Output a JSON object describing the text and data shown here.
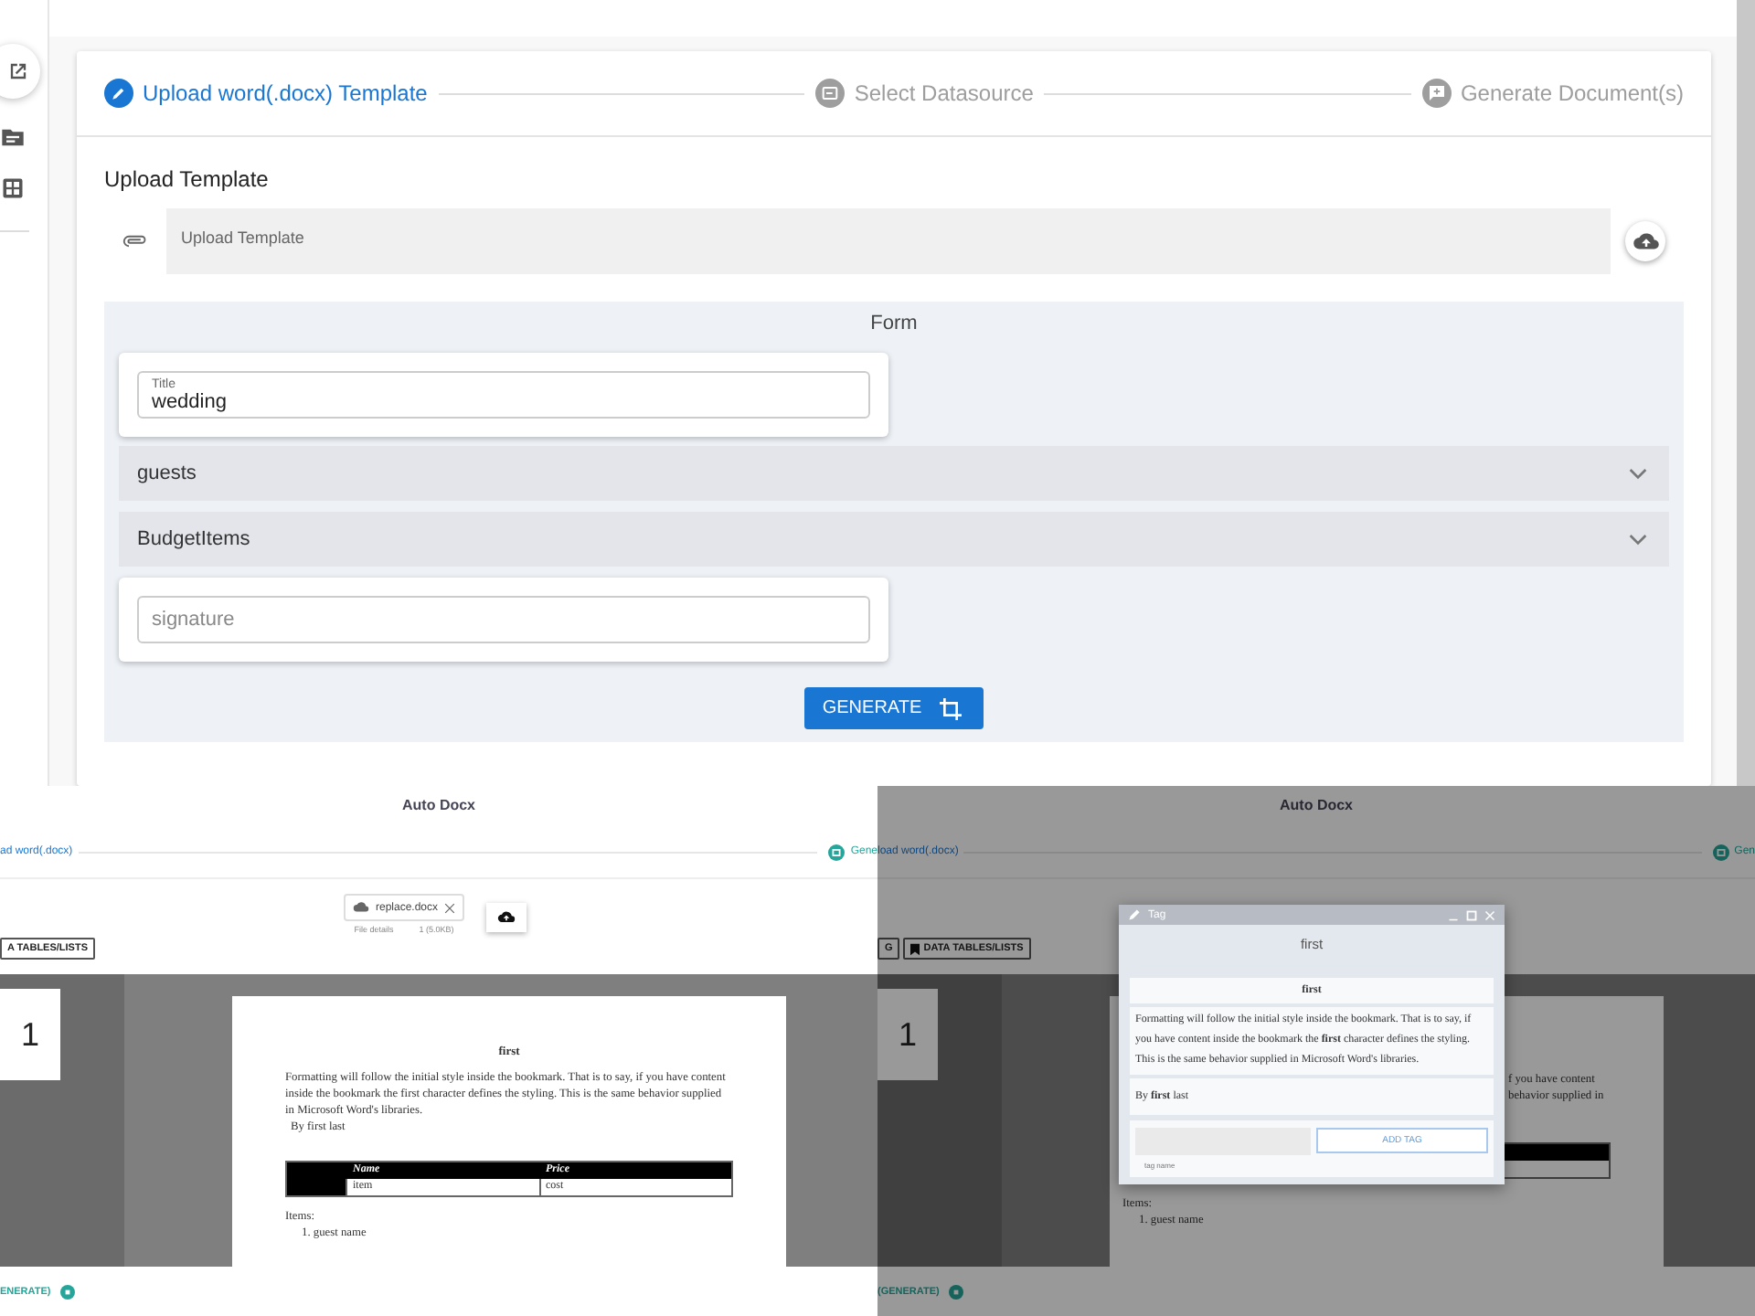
{
  "main": {
    "stepper": [
      {
        "label": "Upload word(.docx) Template",
        "kind": "edit",
        "selected": true
      },
      {
        "label": "Select Datasource",
        "kind": "input",
        "selected": false
      },
      {
        "label": "Generate Document(s)",
        "kind": "comment",
        "selected": false
      }
    ],
    "upload": {
      "heading": "Upload Template",
      "field_label": "Upload Template"
    },
    "form": {
      "title": "Form",
      "items": [
        {
          "kind": "field",
          "label": "Title",
          "value": "wedding"
        },
        {
          "kind": "panel",
          "label": "guests",
          "expanded": false
        },
        {
          "kind": "panel",
          "label": "BudgetItems",
          "expanded": false
        },
        {
          "kind": "field",
          "placeholder": "signature"
        }
      ]
    },
    "generate_button": "GENERATE"
  },
  "preview_left": {
    "title": "Auto Docx",
    "step_label": "ad word(.docx)",
    "step_next": "Gene",
    "file": {
      "name": "replace.docx",
      "details_label": "File details",
      "details_value": "1 (5.0KB)"
    },
    "toolbar_button": "A TABLES/LISTS",
    "page_number": "1",
    "document": {
      "heading": "first",
      "paragraph": "Formatting will follow the initial style inside the bookmark. That is to say, if you have content inside the bookmark the first character defines the styling. This is the same behavior supplied in Microsoft Word's libraries.",
      "byline": "By first last",
      "table": {
        "columns": [
          "Name",
          "Price"
        ],
        "rows": [
          [
            "item",
            "cost"
          ]
        ]
      },
      "list_label": "Items:",
      "list": [
        "1. guest name"
      ]
    },
    "footer_link": "ENERATE)"
  },
  "preview_right": {
    "title": "Auto Docx",
    "step_label": "load word(.docx)",
    "step_next": "Gen",
    "toolbar_buttons": [
      "G",
      "DATA TABLES/LISTS"
    ],
    "page_number": "1",
    "document_fragments": [
      "f you have content",
      "behavior supplied in"
    ],
    "list_label": "Items:",
    "list": [
      "1. guest name"
    ],
    "footer_link": "(GENERATE)",
    "dialog": {
      "title": "Tag",
      "heading": "first",
      "bookmark_heading": "first",
      "paragraph": "Formatting will follow the initial style inside the bookmark. That is to say, if you have content inside the bookmark the **first** character defines the styling. This is the same behavior supplied in Microsoft Word's libraries.",
      "byline": "By **first** last",
      "tag_field_hint": "tag name",
      "add_button": "ADD TAG"
    }
  }
}
